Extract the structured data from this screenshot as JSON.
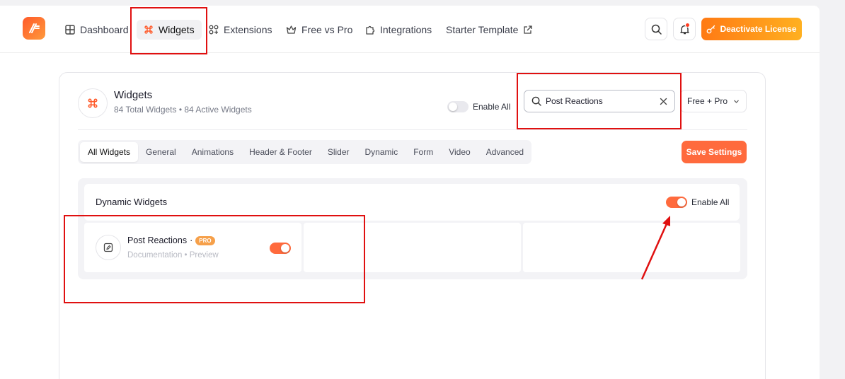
{
  "nav": {
    "dashboard": "Dashboard",
    "widgets": "Widgets",
    "extensions": "Extensions",
    "free_vs_pro": "Free vs Pro",
    "integrations": "Integrations",
    "starter_template": "Starter Template",
    "deactivate": "Deactivate License"
  },
  "widgets_header": {
    "title": "Widgets",
    "subtitle": "84 Total Widgets • 84 Active Widgets",
    "enable_all": "Enable All",
    "search_value": "Post Reactions",
    "filter": "Free + Pro"
  },
  "tabs": [
    "All Widgets",
    "General",
    "Animations",
    "Header & Footer",
    "Slider",
    "Dynamic",
    "Form",
    "Video",
    "Advanced"
  ],
  "save_label": "Save Settings",
  "section": {
    "title": "Dynamic Widgets",
    "enable_all": "Enable All",
    "widget": {
      "name": "Post Reactions",
      "separator": "·",
      "badge": "PRO",
      "links": "Documentation • Preview"
    }
  },
  "colors": {
    "accent": "#ff6a3d",
    "annotation": "#e01010"
  }
}
